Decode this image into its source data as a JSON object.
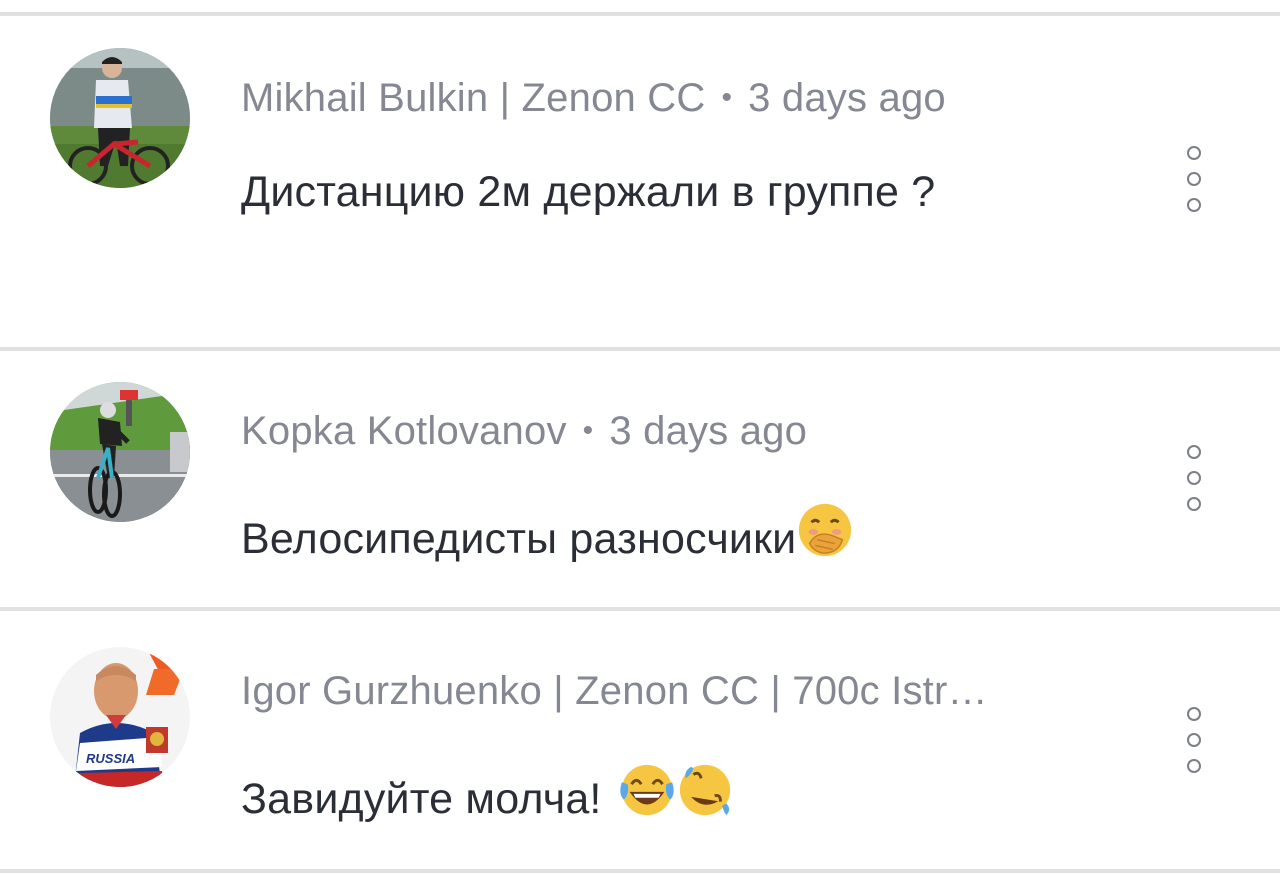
{
  "comments": [
    {
      "author": "Mikhail Bulkin | Zenon CC",
      "separator": "•",
      "time": "3 days ago",
      "text": "Дистанцию 2м держали в группе ?",
      "avatar_icon": "cyclist-photo-avatar"
    },
    {
      "author": "Kopka Kotlovanov",
      "separator": "•",
      "time": "3 days ago",
      "text": "Велосипедисты разносчики",
      "emojis": [
        "face-with-hand-over-mouth"
      ],
      "avatar_icon": "racing-cyclist-photo-avatar"
    },
    {
      "author": "Igor Gurzhuenko | Zenon CC | 700c Istr…",
      "separator": "",
      "time": "",
      "text": "Завидуйте молча!",
      "emojis": [
        "face-with-tears-of-joy",
        "rolling-on-the-floor-laughing"
      ],
      "avatar_icon": "man-in-russia-jersey-avatar"
    }
  ],
  "colors": {
    "meta": "#858892",
    "text": "#2b2e36",
    "divider": "#e1e1e1",
    "menu_icon": "#7d7f86"
  }
}
